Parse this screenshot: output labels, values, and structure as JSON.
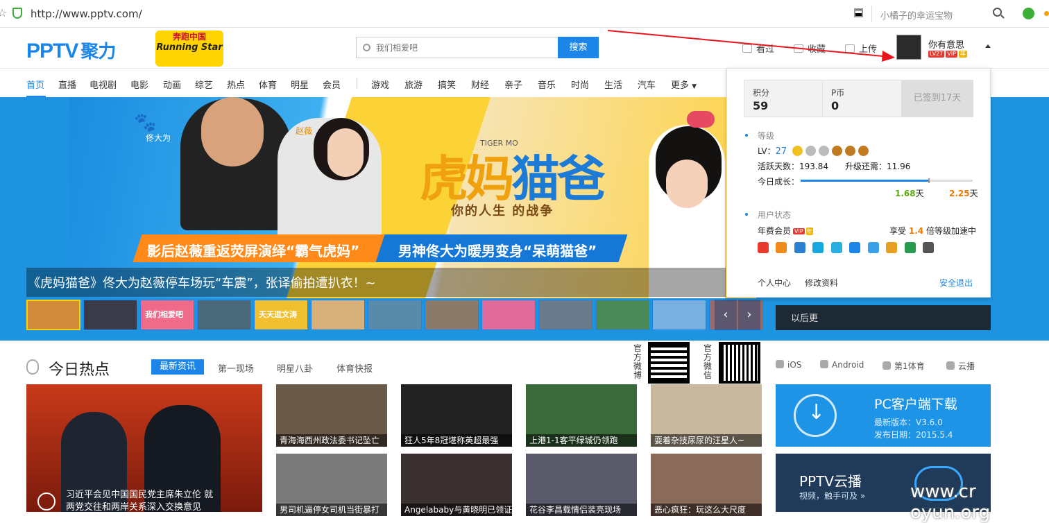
{
  "browser": {
    "url": "http://www.pptv.com/",
    "search_placeholder": "小橘子的幸运宝物"
  },
  "header": {
    "logo_letters": "PPTV",
    "logo_suffix": "聚力",
    "promo_line1": "奔跑中国",
    "promo_line2": "Running Star",
    "search_placeholder": "我们相爱吧",
    "search_button": "搜索",
    "tools": [
      "看过",
      "收藏",
      "上传"
    ],
    "username": "你有意思",
    "user_badges": [
      "LV27",
      "VIP",
      "年"
    ]
  },
  "nav": {
    "items": [
      "首页",
      "直播",
      "电视剧",
      "电影",
      "动画",
      "综艺",
      "热点",
      "体育",
      "明星",
      "会员"
    ],
    "items2": [
      "游戏",
      "旅游",
      "搞笑",
      "财经",
      "亲子",
      "音乐",
      "时尚",
      "生活",
      "汽车"
    ],
    "more": "更多"
  },
  "banner": {
    "title_part1": "虎妈",
    "title_part2": "猫爸",
    "title_en": "TIGER MO",
    "tagline": "你的人生   的战争",
    "credit1": "佟大为",
    "credit2": "赵薇",
    "caption_left": "影后赵薇重返荧屏演绎“霸气虎妈”",
    "caption_right": "男神佟大为暖男变身“呆萌猫爸”",
    "headline": "《虎妈猫爸》佟大为赵薇停车场玩“车震”，张译偷拍遭扒衣！~",
    "thumb_texts": [
      "",
      "",
      "我们相爱吧",
      "",
      "天天逗文涛",
      "",
      "",
      "",
      "",
      "",
      "",
      "",
      ""
    ],
    "prev": "‹",
    "next": "›",
    "right_panel_text": "以后更"
  },
  "dropdown": {
    "points_label": "积分",
    "points_value": "59",
    "pcoin_label": "P币",
    "pcoin_value": "0",
    "signed": "已签到17天",
    "level_section": "等级",
    "lv_label": "LV：",
    "lv_value": "27",
    "active_days": "活跃天数：193.84",
    "upgrade_need": "升级还需：11.96",
    "today_growth": "今日成长：",
    "growth_current": "1.68",
    "growth_target": "2.25",
    "day_unit": "天",
    "progress": 0.746,
    "user_state_section": "用户状态",
    "member_type": "年费会员",
    "member_badge_vip": "VIP",
    "member_badge_year": "年",
    "enjoy_pre": "享受",
    "enjoy_mult": "1.4",
    "enjoy_post": "倍等级加速中",
    "links": [
      "个人中心",
      "修改资料"
    ],
    "logout": "安全退出"
  },
  "hot": {
    "title": "今日热点",
    "tabs": [
      "最新资讯",
      "第一现场",
      "明星八卦",
      "体育快报"
    ],
    "weibo_label": "官方微博",
    "weixin_label": "官方微信",
    "platforms": [
      "iOS",
      "Android",
      "第1体育",
      "云播"
    ],
    "big_caption": "习近平会见中国国民党主席朱立伦 就两党交往和两岸关系深入交换意见",
    "cards": [
      "青海海西州政法委书记坠亡",
      "狂人5年8冠堪称英超最强",
      "上港1-1客平绿城仍领跑",
      "耍着杂技尿尿的汪星人~",
      "男司机逼停女司机当街暴打",
      "Angelababy与黄晓明已领证",
      "花谷李昌载情侣装亮现场",
      "恶心疯狂：玩这么大尺度"
    ],
    "pc_title": "PC客户端下载",
    "pc_version": "最新版本：V3.6.0",
    "pc_date": "发布日期：2015.5.4",
    "yunbo_title": "PPTV云播",
    "yunbo_sub": "视频，触手可及 »"
  },
  "watermark": "www.cr   oyun.org",
  "colors": {
    "brand": "#1b86e8",
    "accent_orange": "#ff8a1a",
    "vip_red": "#e8382f",
    "arrow_red": "#e8141b"
  }
}
